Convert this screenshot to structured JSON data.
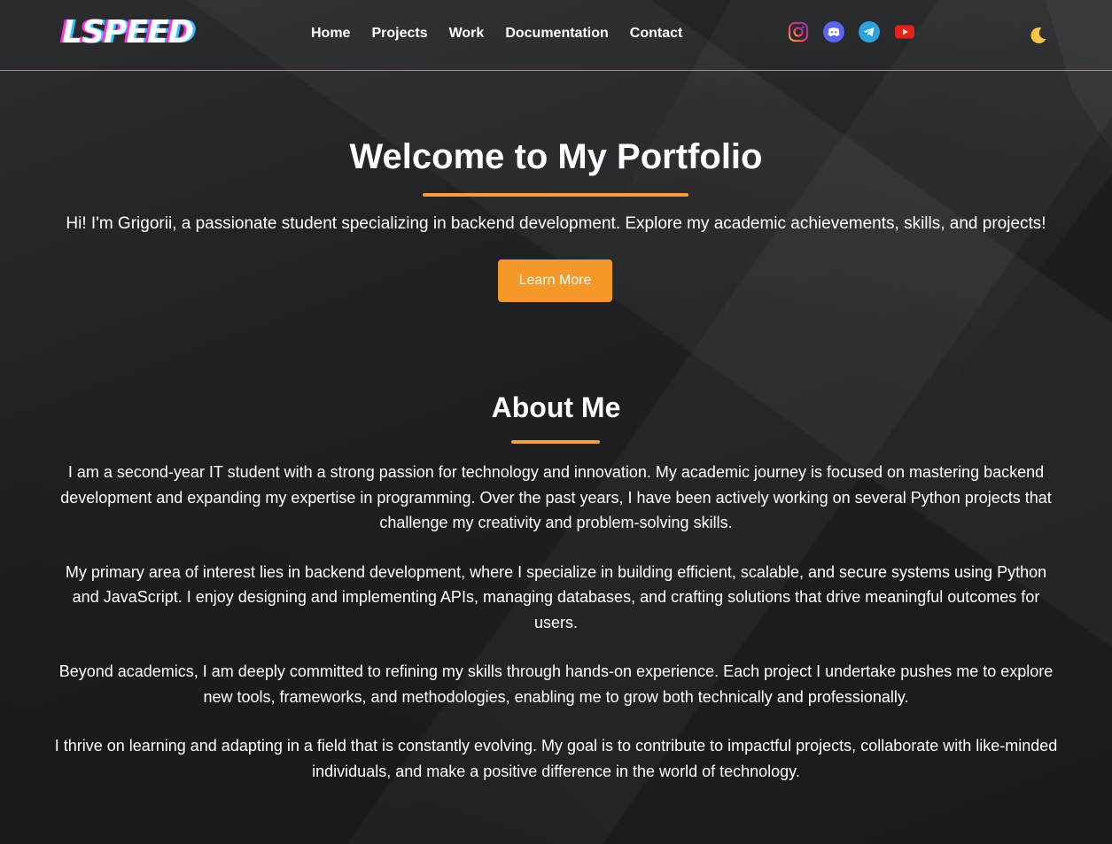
{
  "header": {
    "logo_text": "LSPEED",
    "nav": [
      "Home",
      "Projects",
      "Work",
      "Documentation",
      "Contact"
    ],
    "social_icons": [
      "instagram-icon",
      "discord-icon",
      "telegram-icon",
      "youtube-icon"
    ],
    "theme_icon": "moon-icon"
  },
  "hero": {
    "title": "Welcome to My Portfolio",
    "subtitle": "Hi! I'm Grigorii, a passionate student specializing in backend development. Explore my academic achievements, skills, and projects!",
    "button_label": "Learn More"
  },
  "about": {
    "title": "About Me",
    "paragraphs": [
      "I am a second-year IT student with a strong passion for technology and innovation. My academic journey is focused on mastering backend development and expanding my expertise in programming. Over the past years, I have been actively working on several Python projects that challenge my creativity and problem-solving skills.",
      "My primary area of interest lies in backend development, where I specialize in building efficient, scalable, and secure systems using Python and JavaScript. I enjoy designing and implementing APIs, managing databases, and crafting solutions that drive meaningful outcomes for users.",
      "Beyond academics, I am deeply committed to refining my skills through hands-on experience. Each project I undertake pushes me to explore new tools, frameworks, and methodologies, enabling me to grow both technically and professionally.",
      "I thrive on learning and adapting in a field that is constantly evolving. My goal is to contribute to impactful projects, collaborate with like-minded individuals, and make a positive difference in the world of technology."
    ]
  },
  "colors": {
    "accent": "#f5982a",
    "nav_border": "#c98a3a",
    "background": "#1e1f22"
  }
}
